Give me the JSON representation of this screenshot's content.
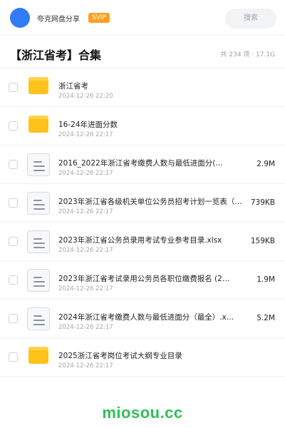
{
  "header": {
    "username": "夸克网盘分享",
    "badge": "SVIP",
    "search_placeholder": "搜索",
    "avatar_color": "#2f7cf6"
  },
  "title": {
    "text": "【浙江省考】合集",
    "meta": "共 234 项 · 17.1G"
  },
  "files": [
    {
      "type": "folder",
      "icon": "folder-icon",
      "name": "浙江省考",
      "date": "2024-12-26 22:20",
      "size": ""
    },
    {
      "type": "folder",
      "icon": "folder-icon",
      "name": "16-24年进面分数",
      "date": "2024-12-26 22:17",
      "size": ""
    },
    {
      "type": "doc",
      "icon": "document-icon",
      "name": "2016_2022年浙江省考缴费人数与最低进面分(…",
      "date": "2024-12-26 22:17",
      "size": "2.9M"
    },
    {
      "type": "doc",
      "icon": "document-icon",
      "name": "2023年浙江省各级机关单位公务员招考计划一览表（…",
      "date": "2024-12-26 22:17",
      "size": "739KB"
    },
    {
      "type": "doc",
      "icon": "document-icon",
      "name": "2023年浙江省公务员录用考试专业参考目录.xlsx",
      "date": "2024-12-26 22:17",
      "size": "159KB"
    },
    {
      "type": "doc",
      "icon": "document-icon",
      "name": "2023年浙江省考试录用公务员各职位缴费报名 (2…",
      "date": "2024-12-26 22:17",
      "size": "1.9M"
    },
    {
      "type": "doc",
      "icon": "document-icon",
      "name": "2024年浙江省考缴费人数与最低进面分（最全）.x…",
      "date": "2024-12-26 22:17",
      "size": "5.2M"
    },
    {
      "type": "folder",
      "icon": "folder-icon",
      "name": "2025浙江省考岗位考试大纲专业目录",
      "date": "2024-12-26 22:17",
      "size": ""
    }
  ],
  "watermark": "miosou.cc",
  "colors": {
    "accent": "#2f7cf6",
    "badge": "#ff9f22",
    "folder": "#ffc21a",
    "watermark": "#2fbf55"
  }
}
